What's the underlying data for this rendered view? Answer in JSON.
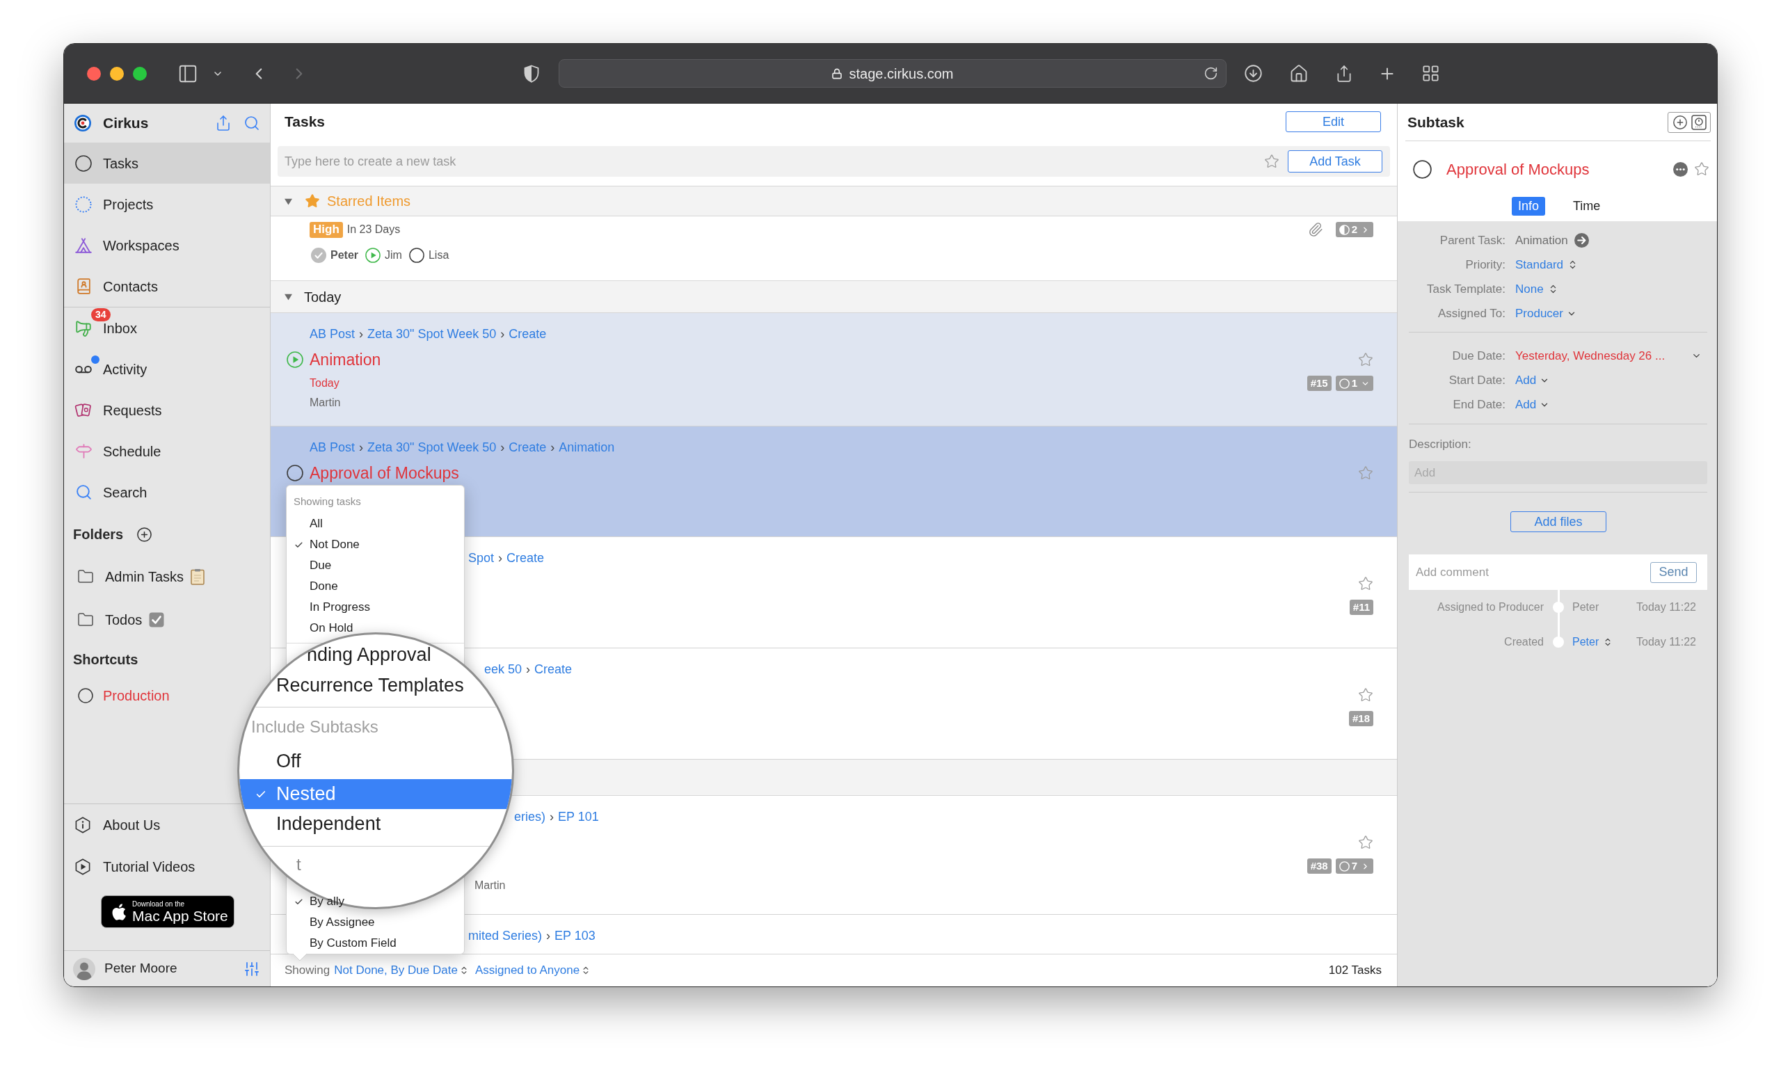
{
  "browser": {
    "url": "stage.cirkus.com"
  },
  "sidebar": {
    "app_name": "Cirkus",
    "nav": [
      {
        "label": "Tasks",
        "selected": true
      },
      {
        "label": "Projects",
        "selected": false
      },
      {
        "label": "Workspaces",
        "selected": false
      },
      {
        "label": "Contacts",
        "selected": false
      }
    ],
    "nav2": [
      {
        "label": "Inbox",
        "selected": false,
        "unread_dot": false,
        "badge": "34"
      },
      {
        "label": "Activity",
        "selected": false,
        "unread_dot": true
      },
      {
        "label": "Requests",
        "selected": false,
        "unread_dot": false
      },
      {
        "label": "Schedule",
        "selected": false,
        "unread_dot": false
      },
      {
        "label": "Search",
        "selected": false,
        "unread_dot": false
      }
    ],
    "folders": {
      "title": "Folders",
      "items": [
        {
          "label": "Admin Tasks"
        },
        {
          "label": "Todos"
        }
      ]
    },
    "shortcuts": {
      "title": "Shortcuts",
      "items": [
        {
          "label": "Production"
        }
      ]
    },
    "links": [
      {
        "label": "About Us"
      },
      {
        "label": "Tutorial Videos"
      }
    ],
    "store_badge": {
      "small_text": "Download on the",
      "large_text": "Mac App Store"
    },
    "user": {
      "name": "Peter Moore"
    }
  },
  "tasks": {
    "title": "Tasks",
    "edit_button": "Edit",
    "new_task": {
      "placeholder": "Type here to create a new task",
      "starred": false
    },
    "add_button": "Add Task",
    "sections": [
      {
        "kind": "starred",
        "title": "Starred Items",
        "expanded": true,
        "tasks": [
          {
            "kind": "summary",
            "selected": false,
            "parent_highlight": false,
            "priority": "High",
            "due": "In 23 Days",
            "attachment": true,
            "assignees": [
              {
                "name": "Peter",
                "done": true,
                "started": false,
                "current_user": true
              },
              {
                "name": "Jim",
                "done": false,
                "started": true,
                "current_user": false
              },
              {
                "name": "Lisa",
                "done": false,
                "started": false,
                "current_user": false
              }
            ],
            "badges": [
              {
                "kind": "subtasks",
                "half_done": true,
                "text": "2",
                "expanded": false
              }
            ]
          }
        ]
      },
      {
        "kind": "date",
        "title": "Today",
        "expanded": true,
        "tasks": [
          {
            "kind": "full",
            "selected": false,
            "parent_highlight": true,
            "breadcrumb": [
              {
                "kind": "link",
                "text": "AB Post"
              },
              {
                "kind": "separator",
                "text": "›"
              },
              {
                "kind": "link",
                "text": "Zeta 30\" Spot Week 50"
              },
              {
                "kind": "separator",
                "text": "›"
              },
              {
                "kind": "link",
                "text": "Create"
              }
            ],
            "done": false,
            "started": true,
            "title": "Animation",
            "due": "Today",
            "assignee": "Martin",
            "starred": false,
            "badges": [
              {
                "kind": "id",
                "text": "#15"
              },
              {
                "kind": "subtasks",
                "half_done": false,
                "text": "1",
                "expanded": true
              }
            ]
          },
          {
            "kind": "full",
            "selected": true,
            "parent_highlight": false,
            "breadcrumb": [
              {
                "kind": "link",
                "text": "AB Post"
              },
              {
                "kind": "separator",
                "text": "›"
              },
              {
                "kind": "link",
                "text": "Zeta 30\" Spot Week 50"
              },
              {
                "kind": "separator",
                "text": "›"
              },
              {
                "kind": "link",
                "text": "Create"
              },
              {
                "kind": "separator",
                "text": "›"
              },
              {
                "kind": "link",
                "text": "Animation"
              }
            ],
            "done": false,
            "started": false,
            "title": "Approval of Mockups",
            "starred": false
          },
          {
            "kind": "full",
            "selected": false,
            "parent_highlight": false,
            "breadcrumb": [
              {
                "kind": "link",
                "text": "Spot"
              },
              {
                "kind": "separator",
                "text": "›"
              },
              {
                "kind": "link",
                "text": "Create"
              }
            ],
            "starred": false,
            "badges": [
              {
                "kind": "id",
                "text": "#11"
              }
            ]
          },
          {
            "kind": "full",
            "selected": false,
            "parent_highlight": false,
            "breadcrumb": [
              {
                "kind": "link",
                "text": "eek 50"
              },
              {
                "kind": "separator",
                "text": "›"
              },
              {
                "kind": "link",
                "text": "Create"
              }
            ],
            "starred": false,
            "badges": [
              {
                "kind": "id",
                "text": "#18"
              }
            ]
          }
        ]
      },
      {
        "kind": "date",
        "tasks": [
          {
            "kind": "full",
            "selected": false,
            "parent_highlight": false,
            "breadcrumb": [
              {
                "kind": "link",
                "text": "eries)"
              },
              {
                "kind": "separator",
                "text": "›"
              },
              {
                "kind": "link",
                "text": "EP 101"
              }
            ],
            "assignee": "Martin",
            "starred": false,
            "badges": [
              {
                "kind": "id",
                "text": "#38"
              },
              {
                "kind": "subtasks",
                "half_done": false,
                "text": "7",
                "expanded": false
              }
            ]
          },
          {
            "kind": "full",
            "selected": false,
            "parent_highlight": false,
            "breadcrumb": [
              {
                "kind": "link",
                "text": "mited Series)"
              },
              {
                "kind": "separator",
                "text": "›"
              },
              {
                "kind": "link",
                "text": "EP 103"
              }
            ]
          }
        ]
      }
    ],
    "footer": {
      "label": "Showing",
      "filter": "Not Done, By Due Date",
      "assignee_filter": "Assigned to Anyone",
      "count": "102 Tasks"
    }
  },
  "filter_menu": {
    "header": "Showing tasks",
    "items": [
      {
        "label": "All",
        "checked": false
      },
      {
        "label": "Not Done",
        "checked": true
      },
      {
        "label": "Due",
        "checked": false
      },
      {
        "label": "Done",
        "checked": false
      },
      {
        "label": "In Progress",
        "checked": false
      },
      {
        "label": "On Hold",
        "checked": false
      }
    ],
    "sort_items": [
      {
        "label": "By ally",
        "checked": true
      },
      {
        "label": "By Assignee",
        "checked": false
      },
      {
        "label": "By Custom Field",
        "checked": false
      }
    ]
  },
  "magnifier": {
    "items": [
      {
        "label": "nding Approval"
      },
      {
        "label": "Recurrence Templates"
      }
    ],
    "subtasks_header": "Include Subtasks",
    "subtask_options": [
      {
        "label": "Off",
        "selected": false
      },
      {
        "label": "Nested",
        "selected": true
      },
      {
        "label": "Independent",
        "selected": false
      }
    ],
    "next_header": "t"
  },
  "detail": {
    "title": "Subtask",
    "task": {
      "title": "Approval of Mockups",
      "done": false,
      "starred": false
    },
    "tabs": [
      {
        "label": "Info",
        "selected": true
      },
      {
        "label": "Time",
        "selected": false
      }
    ],
    "fields": [
      {
        "kind": "link",
        "label": "Parent Task:",
        "value": "Animation"
      },
      {
        "kind": "stepper",
        "label": "Priority:",
        "value": "Standard"
      },
      {
        "kind": "stepper",
        "label": "Task Template:",
        "value": "None"
      },
      {
        "kind": "dropdown",
        "label": "Assigned To:",
        "value": "Producer"
      }
    ],
    "dates": [
      {
        "kind": "overdue",
        "label": "Due Date:",
        "value": "Yesterday, Wednesday 26 ..."
      },
      {
        "kind": "dropdown",
        "label": "Start Date:",
        "value": "Add"
      },
      {
        "kind": "dropdown",
        "label": "End Date:",
        "value": "Add"
      }
    ],
    "description": {
      "label": "Description:",
      "placeholder": "Add"
    },
    "add_files": "Add files",
    "comment": {
      "placeholder": "Add comment",
      "send": "Send"
    },
    "history": [
      {
        "kind": "plain",
        "event": "Assigned to Producer",
        "user": "Peter",
        "time": "Today 11:22"
      },
      {
        "kind": "stepper",
        "event": "Created",
        "user": "Peter",
        "time": "Today 11:22"
      }
    ]
  }
}
